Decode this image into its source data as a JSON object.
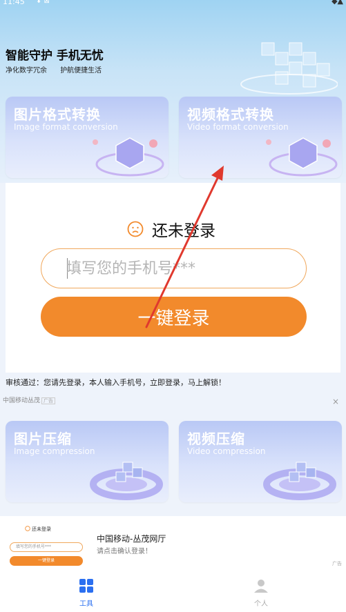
{
  "status_bar": {
    "time": "11:45",
    "left_icons": "⬇ ⊠",
    "right_icons": "◆▲"
  },
  "hero": {
    "title": "智能守护 手机无忧",
    "subtitle_1": "净化数字冗余",
    "subtitle_2": "护航便捷生活"
  },
  "cards": {
    "image_convert": {
      "title": "图片格式转换",
      "subtitle": "Image format conversion"
    },
    "video_convert": {
      "title": "视频格式转换",
      "subtitle": "Video format conversion"
    },
    "image_compress": {
      "title": "图片压缩",
      "subtitle": "Image compression"
    },
    "video_compress": {
      "title": "视频压缩",
      "subtitle": "Video compression"
    }
  },
  "login": {
    "status": "还未登录",
    "phone_placeholder": "填写您的手机号***",
    "button_label": "一键登录"
  },
  "notice": "审核通过：您请先登录，本人输入手机号，立即登录，马上解锁！",
  "ad_inline": {
    "text": "中国移动丛茂",
    "tag": "广告",
    "close": "×"
  },
  "bottom_ad": {
    "mini_header": "还未登录",
    "mini_input": "填写您的手机号***",
    "mini_button": "一键登录",
    "title": "中国移动-丛茂网厅",
    "desc": "请点击确认登录！",
    "mark": "广告"
  },
  "tabbar": {
    "tools": {
      "label": "工具",
      "icon": "grid-icon",
      "active": true
    },
    "profile": {
      "label": "个人",
      "icon": "person-icon",
      "active": false
    }
  },
  "colors": {
    "accent": "#f28a2c",
    "tab_active": "#2b6ff0",
    "arrow": "#e0392e"
  }
}
